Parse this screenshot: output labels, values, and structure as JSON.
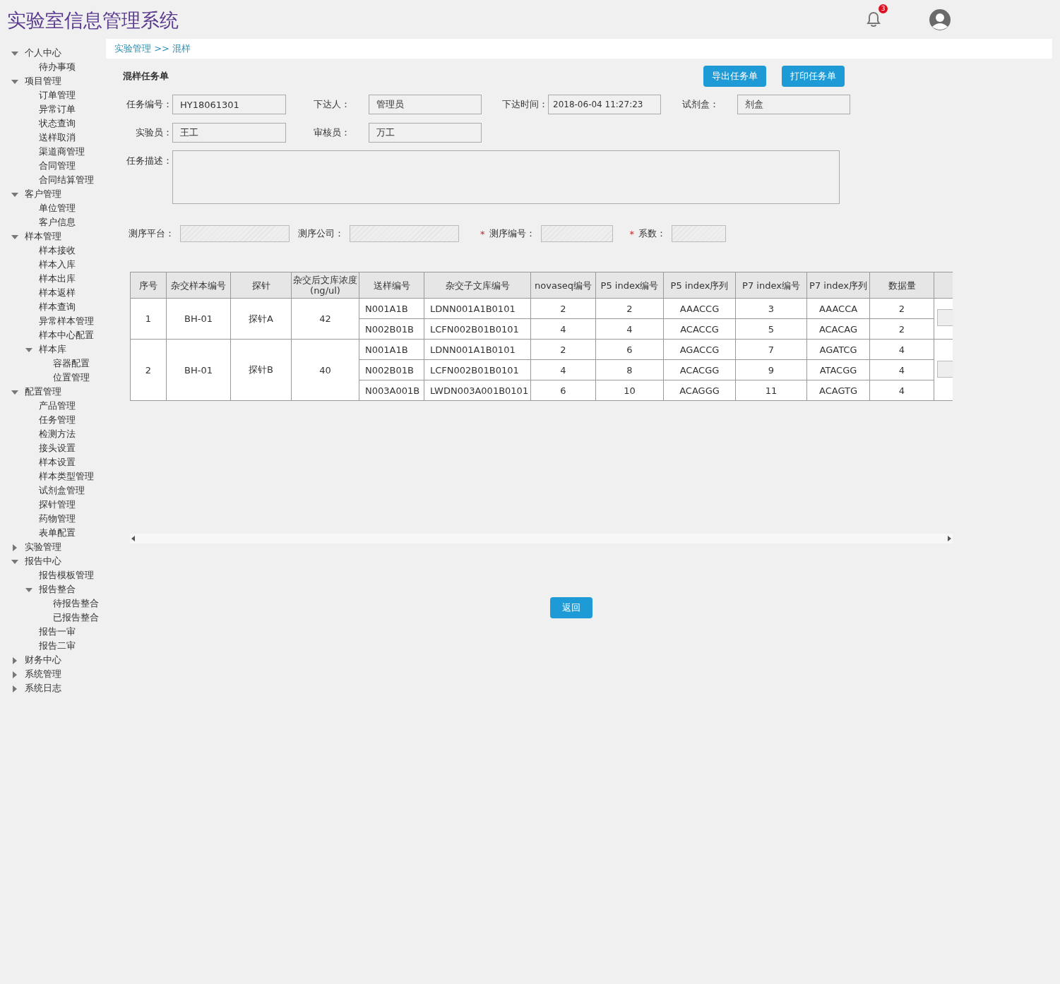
{
  "header": {
    "title": "实验室信息管理系统",
    "notification_count": "3"
  },
  "sidebar": {
    "items": [
      {
        "label": "个人中心",
        "expanded": true,
        "children": [
          {
            "label": "待办事项"
          }
        ]
      },
      {
        "label": "项目管理",
        "expanded": true,
        "children": [
          {
            "label": "订单管理"
          },
          {
            "label": "异常订单"
          },
          {
            "label": "状态查询"
          },
          {
            "label": "送样取消"
          },
          {
            "label": "渠道商管理"
          },
          {
            "label": "合同管理"
          },
          {
            "label": "合同结算管理"
          }
        ]
      },
      {
        "label": "客户管理",
        "expanded": true,
        "children": [
          {
            "label": "单位管理"
          },
          {
            "label": "客户信息"
          }
        ]
      },
      {
        "label": "样本管理",
        "expanded": true,
        "children": [
          {
            "label": "样本接收"
          },
          {
            "label": "样本入库"
          },
          {
            "label": "样本出库"
          },
          {
            "label": "样本返样"
          },
          {
            "label": "样本查询"
          },
          {
            "label": "异常样本管理"
          },
          {
            "label": "样本中心配置"
          },
          {
            "label": "样本库",
            "expanded": true,
            "children": [
              {
                "label": "容器配置"
              },
              {
                "label": "位置管理"
              }
            ]
          }
        ]
      },
      {
        "label": "配置管理",
        "expanded": true,
        "children": [
          {
            "label": "产品管理"
          },
          {
            "label": "任务管理"
          },
          {
            "label": "检测方法"
          },
          {
            "label": "接头设置"
          },
          {
            "label": "样本设置"
          },
          {
            "label": "样本类型管理"
          },
          {
            "label": "试剂盒管理"
          },
          {
            "label": "探针管理"
          },
          {
            "label": "药物管理"
          },
          {
            "label": "表单配置"
          }
        ]
      },
      {
        "label": "实验管理",
        "expanded": false
      },
      {
        "label": "报告中心",
        "expanded": true,
        "children": [
          {
            "label": "报告模板管理"
          },
          {
            "label": "报告整合",
            "expanded": true,
            "children": [
              {
                "label": "待报告整合"
              },
              {
                "label": "已报告整合"
              }
            ]
          },
          {
            "label": "报告一审"
          },
          {
            "label": "报告二审"
          }
        ]
      },
      {
        "label": "财务中心",
        "expanded": false
      },
      {
        "label": "系统管理",
        "expanded": false
      },
      {
        "label": "系统日志",
        "expanded": false
      }
    ]
  },
  "breadcrumb": "实验管理 >> 混样",
  "section_title": "混样任务单",
  "actions": [
    "导出任务单",
    "打印任务单"
  ],
  "form_rows": [
    [
      {
        "label": "任务编号：",
        "value": "HY18061301"
      },
      {
        "label": "下达人：",
        "value": "管理员"
      },
      {
        "label": "下达时间：",
        "value": "2018-06-04 11:27:23"
      },
      {
        "label": "试剂盒：",
        "value": "剂盒"
      }
    ],
    [
      {
        "label": "实验员：",
        "value": "王工"
      },
      {
        "label": "审核员：",
        "value": "万工"
      }
    ]
  ],
  "description": {
    "label": "任务描述："
  },
  "sequencing_fields": [
    {
      "label": "测序平台："
    },
    {
      "label": "测序公司："
    },
    {
      "label": "测序编号：",
      "required_mark": "*"
    },
    {
      "label": "系数：",
      "required_mark": "*"
    }
  ],
  "table": {
    "columns": [
      "序号",
      "杂交样本编号",
      "探针",
      "杂交后文库浓度\n(ng/ul)",
      "送样编号",
      "杂交子文库编号",
      "novaseq编号",
      "P5 index编号",
      "P5 index序列",
      "P7 index编号",
      "P7 index序列",
      "数据量"
    ],
    "groups": [
      {
        "index": "1",
        "sample": "BH-01",
        "probe": "探针A",
        "concentration": "42",
        "rows": [
          [
            "N001A1B",
            "LDNN001A1B0101",
            "2",
            "2",
            "AAACCG",
            "3",
            "AAACCA",
            "2"
          ],
          [
            "N002B01B",
            "LCFN002B01B0101",
            "4",
            "4",
            "ACACCG",
            "5",
            "ACACAG",
            "2"
          ]
        ]
      },
      {
        "index": "2",
        "sample": "BH-01",
        "probe": "探针B",
        "concentration": "40",
        "rows": [
          [
            "N001A1B",
            "LDNN001A1B0101",
            "2",
            "6",
            "AGACCG",
            "7",
            "AGATCG",
            "4"
          ],
          [
            "N002B01B",
            "LCFN002B01B0101",
            "4",
            "8",
            "ACACGG",
            "9",
            "ATACGG",
            "4"
          ],
          [
            "N003A001B",
            "LWDN003A001B0101",
            "6",
            "10",
            "ACAGGG",
            "11",
            "ACAGTG",
            "4"
          ]
        ]
      }
    ]
  },
  "back_button": "返回"
}
